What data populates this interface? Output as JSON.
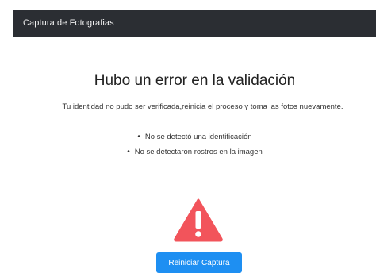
{
  "window": {
    "title": "Captura de Fotografias"
  },
  "error": {
    "heading": "Hubo un error en la validación",
    "message": "Tu identidad no pudo ser verificada,reinicia el proceso y toma las fotos nuevamente.",
    "reasons": [
      "No se detectó una identificación",
      "No se detectaron rostros en la imagen"
    ],
    "icon": "warning-triangle-icon",
    "icon_color": "#f2545b"
  },
  "actions": {
    "restart_label": "Reiniciar Captura",
    "restart_color": "#1e8ff2"
  }
}
